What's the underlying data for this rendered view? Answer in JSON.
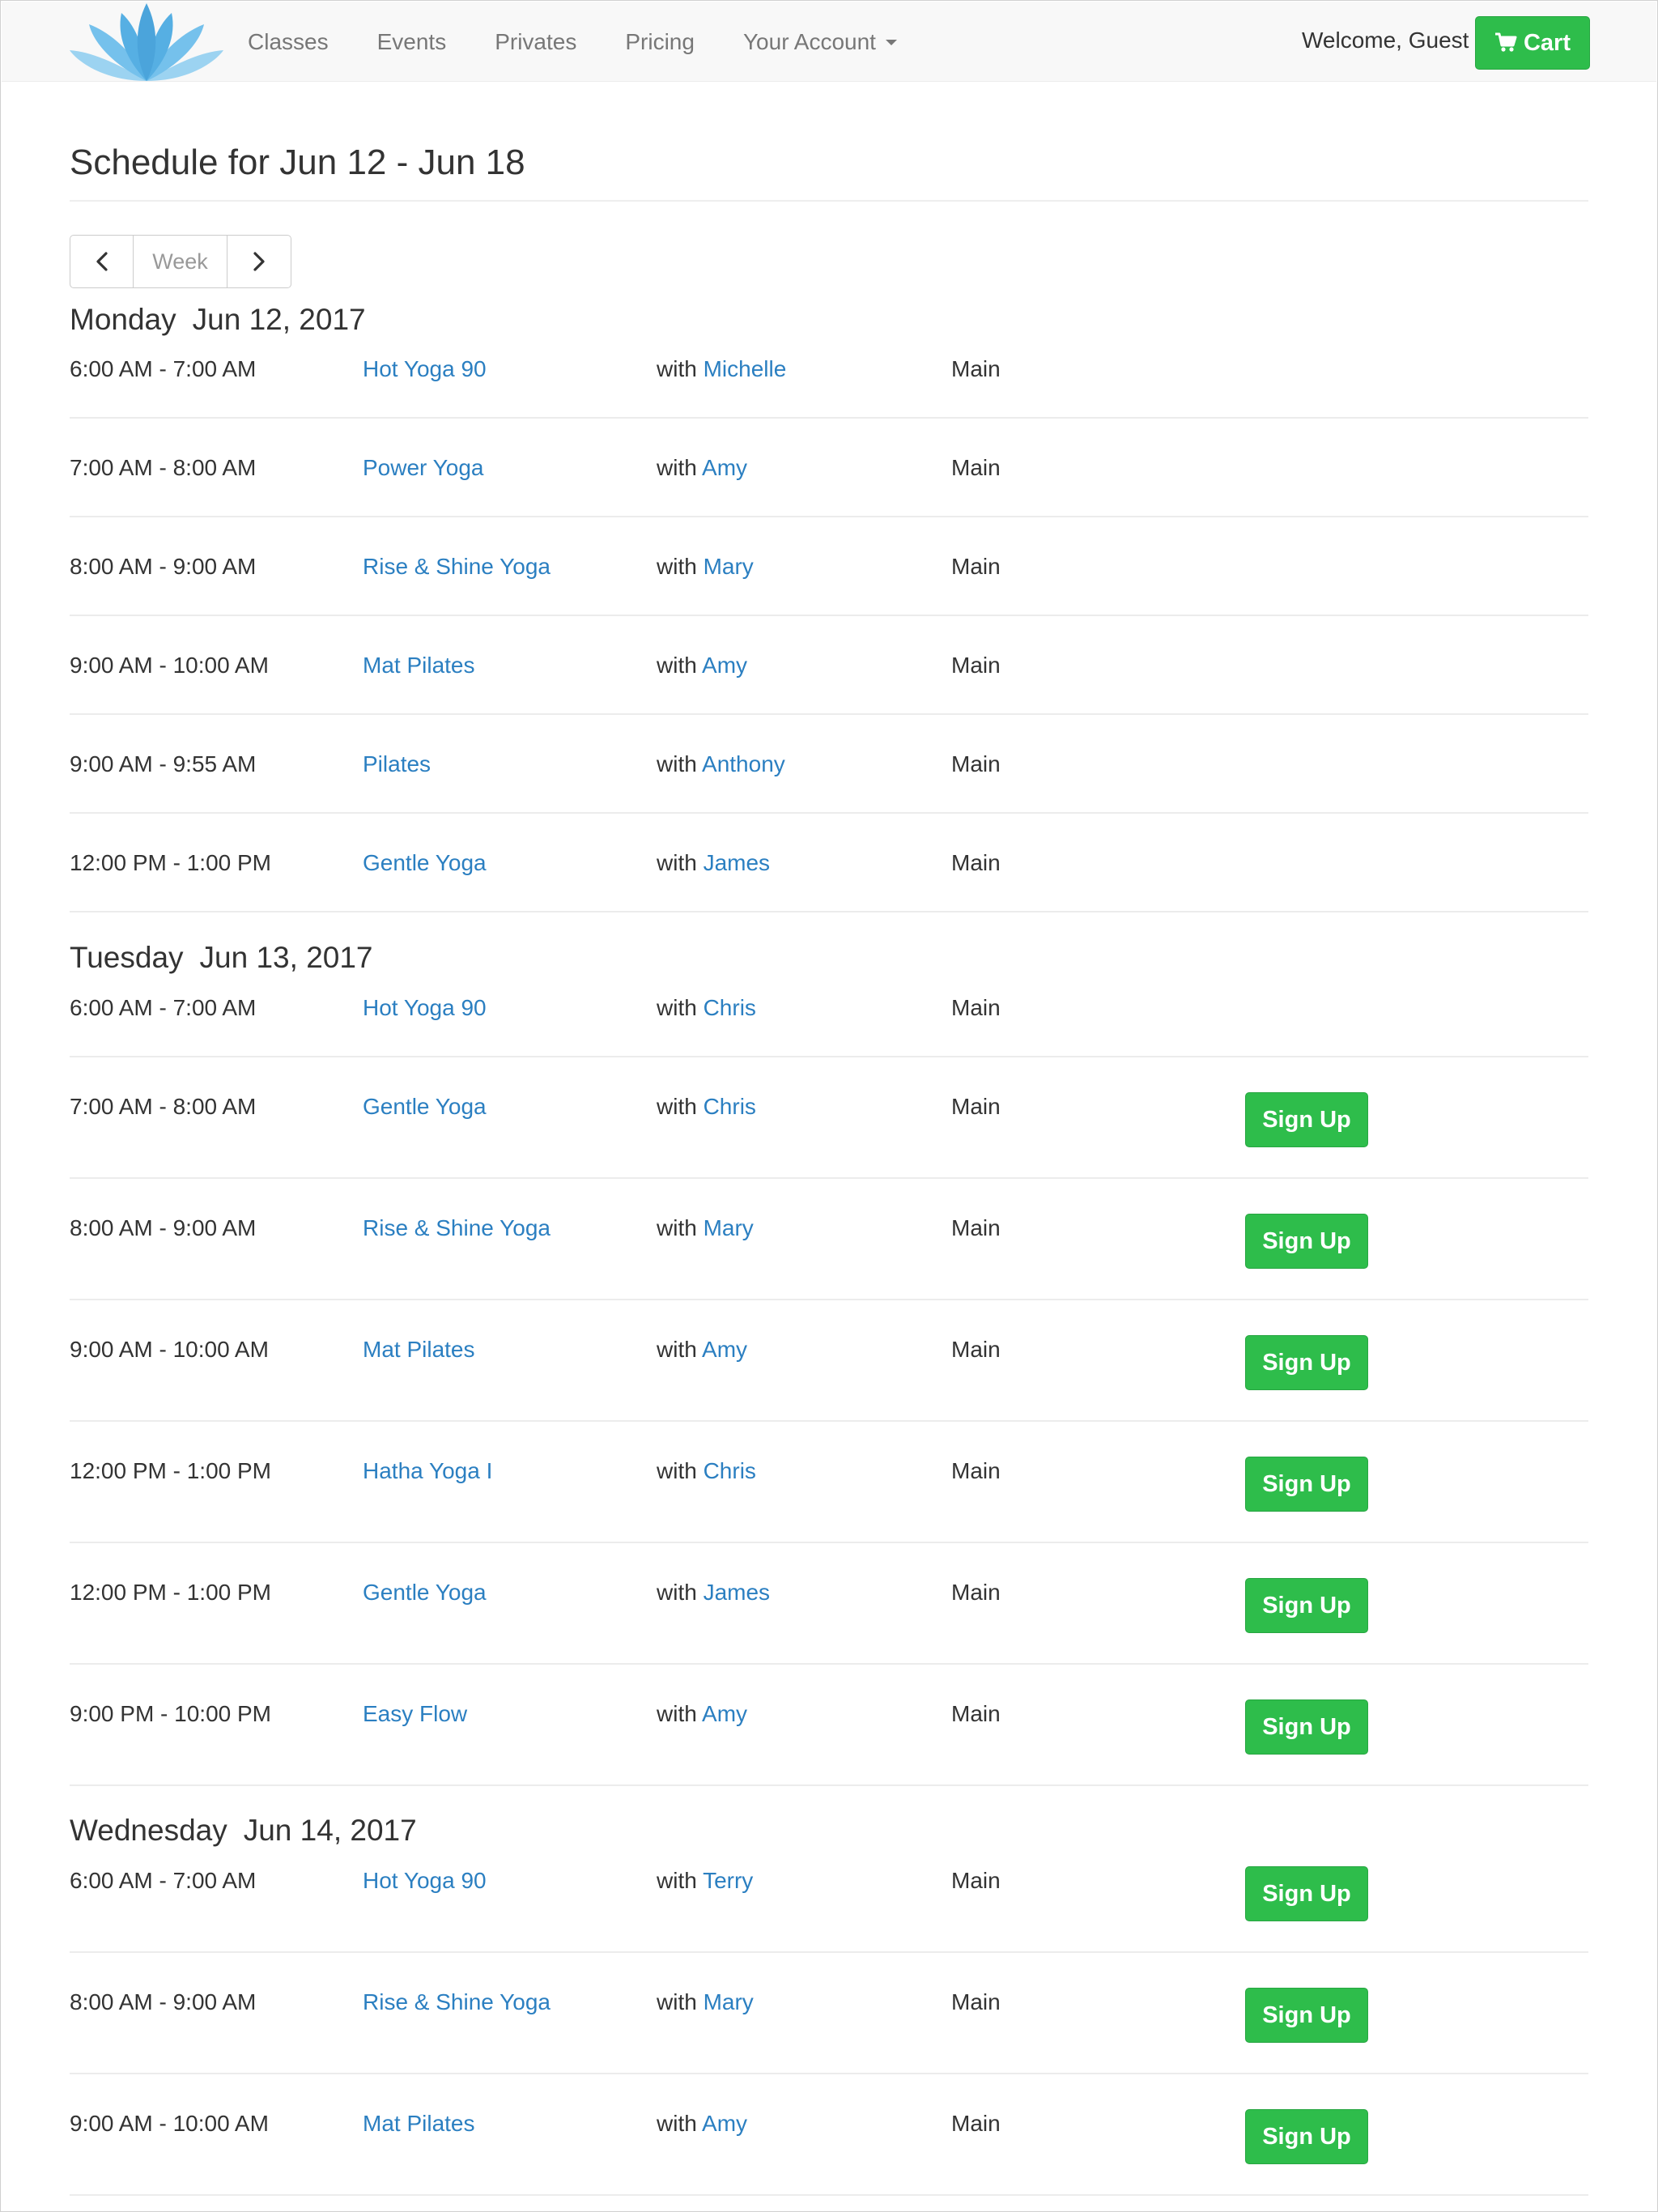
{
  "nav": {
    "links": [
      {
        "label": "Classes"
      },
      {
        "label": "Events"
      },
      {
        "label": "Privates"
      },
      {
        "label": "Pricing"
      },
      {
        "label": "Your Account"
      }
    ],
    "welcome": "Welcome, Guest",
    "cart_label": "Cart"
  },
  "colors": {
    "accent_green": "#2ebd4b",
    "link_blue": "#2b7fc1",
    "logo_blue": "#4fb0e6"
  },
  "schedule": {
    "title": "Schedule for Jun 12 - Jun 18",
    "week_label": "Week",
    "with_label": "with",
    "signup_label": "Sign Up",
    "days": [
      {
        "day_name": "Monday",
        "date": "Jun 12, 2017",
        "classes": [
          {
            "time": "6:00 AM - 7:00 AM",
            "name": "Hot Yoga 90",
            "instructor": "Michelle",
            "room": "Main",
            "signup": false
          },
          {
            "time": "7:00 AM - 8:00 AM",
            "name": "Power Yoga",
            "instructor": "Amy",
            "room": "Main",
            "signup": false
          },
          {
            "time": "8:00 AM - 9:00 AM",
            "name": "Rise & Shine Yoga",
            "instructor": "Mary",
            "room": "Main",
            "signup": false
          },
          {
            "time": "9:00 AM - 10:00 AM",
            "name": "Mat Pilates",
            "instructor": "Amy",
            "room": "Main",
            "signup": false
          },
          {
            "time": "9:00 AM - 9:55 AM",
            "name": "Pilates",
            "instructor": "Anthony",
            "room": "Main",
            "signup": false
          },
          {
            "time": "12:00 PM - 1:00 PM",
            "name": "Gentle Yoga",
            "instructor": "James",
            "room": "Main",
            "signup": false
          }
        ]
      },
      {
        "day_name": "Tuesday",
        "date": "Jun 13, 2017",
        "classes": [
          {
            "time": "6:00 AM - 7:00 AM",
            "name": "Hot Yoga 90",
            "instructor": "Chris",
            "room": "Main",
            "signup": false
          },
          {
            "time": "7:00 AM - 8:00 AM",
            "name": "Gentle Yoga",
            "instructor": "Chris",
            "room": "Main",
            "signup": true
          },
          {
            "time": "8:00 AM - 9:00 AM",
            "name": "Rise & Shine Yoga",
            "instructor": "Mary",
            "room": "Main",
            "signup": true
          },
          {
            "time": "9:00 AM - 10:00 AM",
            "name": "Mat Pilates",
            "instructor": "Amy",
            "room": "Main",
            "signup": true
          },
          {
            "time": "12:00 PM - 1:00 PM",
            "name": "Hatha Yoga I",
            "instructor": "Chris",
            "room": "Main",
            "signup": true
          },
          {
            "time": "12:00 PM - 1:00 PM",
            "name": "Gentle Yoga",
            "instructor": "James",
            "room": "Main",
            "signup": true
          },
          {
            "time": "9:00 PM - 10:00 PM",
            "name": "Easy Flow",
            "instructor": "Amy",
            "room": "Main",
            "signup": true
          }
        ]
      },
      {
        "day_name": "Wednesday",
        "date": "Jun 14, 2017",
        "classes": [
          {
            "time": "6:00 AM - 7:00 AM",
            "name": "Hot Yoga 90",
            "instructor": "Terry",
            "room": "Main",
            "signup": true
          },
          {
            "time": "8:00 AM - 9:00 AM",
            "name": "Rise & Shine Yoga",
            "instructor": "Mary",
            "room": "Main",
            "signup": true
          },
          {
            "time": "9:00 AM - 10:00 AM",
            "name": "Mat Pilates",
            "instructor": "Amy",
            "room": "Main",
            "signup": true
          }
        ]
      }
    ]
  }
}
